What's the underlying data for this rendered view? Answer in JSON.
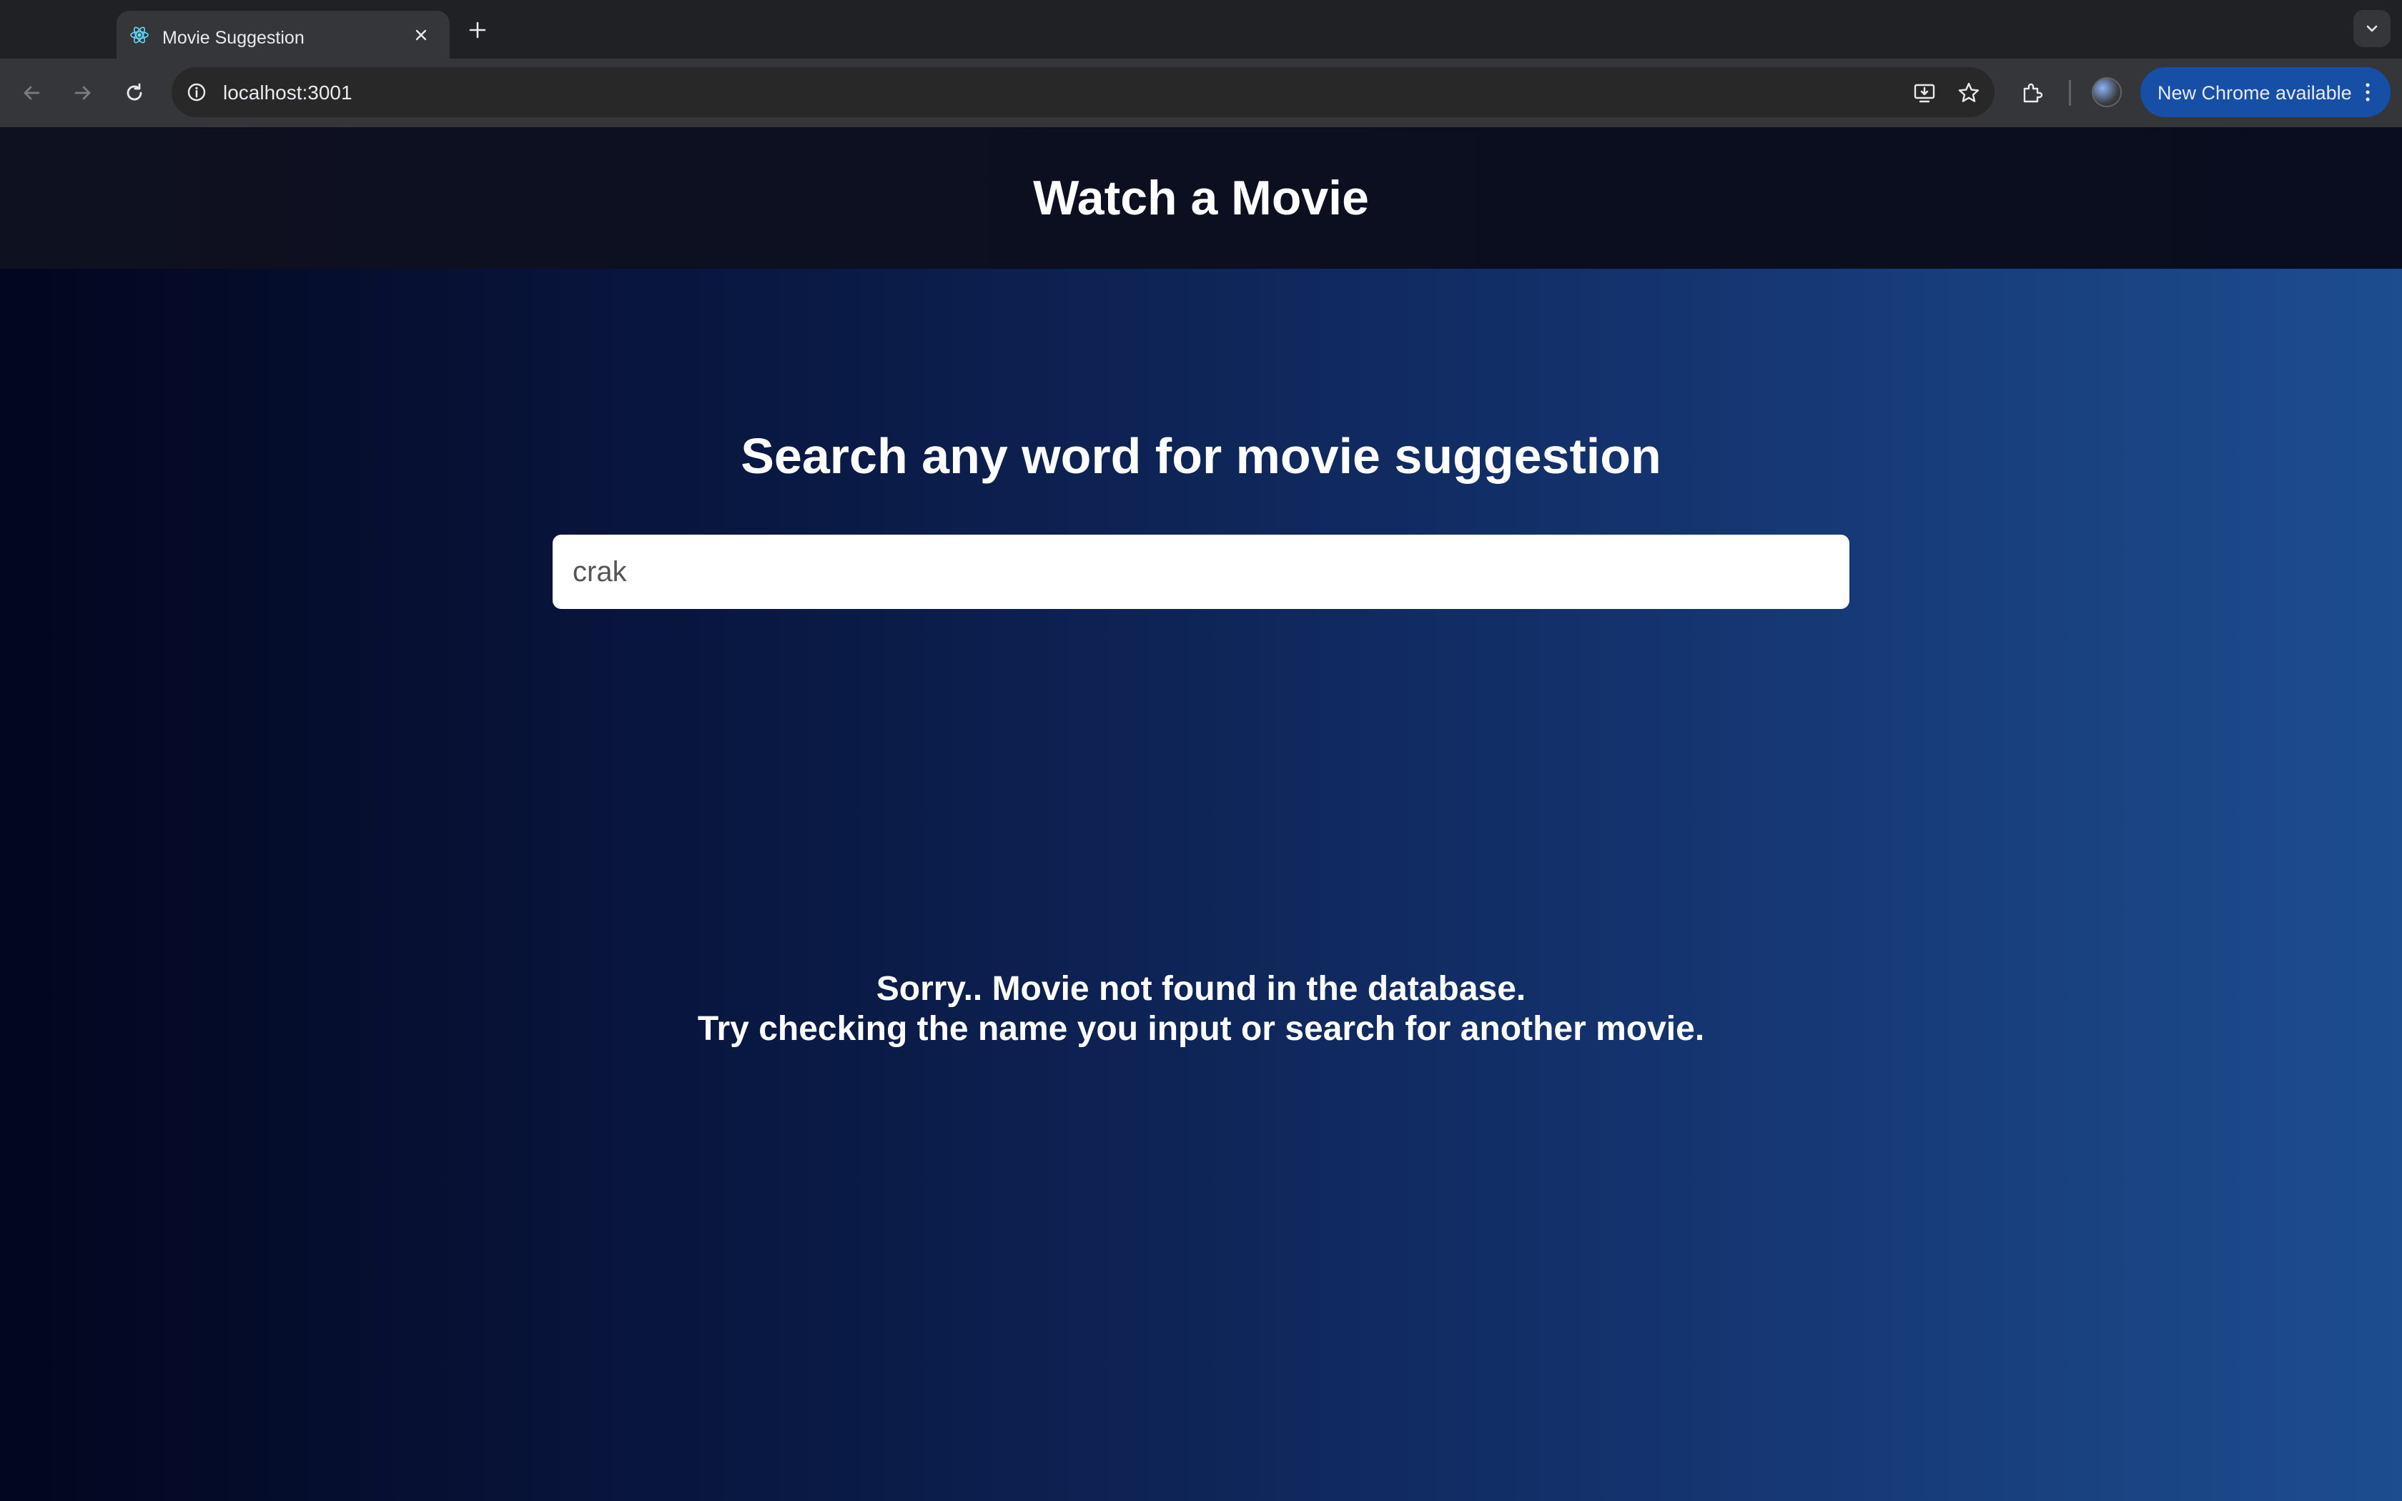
{
  "browser": {
    "tab": {
      "title": "Movie Suggestion",
      "favicon": "react-icon"
    },
    "address": {
      "url": "localhost:3001"
    },
    "update_button": {
      "label": "New Chrome available"
    },
    "colors": {
      "tabstrip": "#202124",
      "toolbar": "#35363a",
      "update_button": "#174ea6"
    }
  },
  "site": {
    "header": {
      "title": "Watch a Movie"
    },
    "search": {
      "heading": "Search any word for movie suggestion",
      "query": "crak"
    },
    "result": {
      "line1": "Sorry.. Movie not found in the database.",
      "line2": "Try checking the name you input or search for another movie."
    },
    "colors": {
      "header_bg": "#0b0f20",
      "gradient_start": "#02061f",
      "gradient_end": "#1d4d8f",
      "text": "#ffffff"
    }
  }
}
